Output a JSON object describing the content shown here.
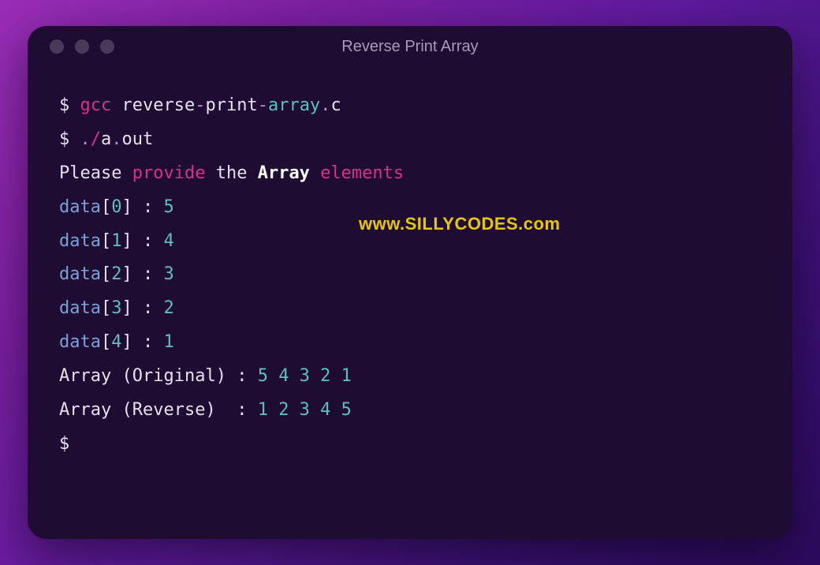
{
  "window": {
    "title": "Reverse Print Array"
  },
  "terminal": {
    "line1": {
      "prompt": "$ ",
      "gcc": "gcc",
      "sp1": " ",
      "reverse": "reverse",
      "dash1": "-",
      "print": "print",
      "dash2": "-",
      "array": "array",
      "dot": ".",
      "c": "c"
    },
    "line2": {
      "prompt": "$ ",
      "dot1": ".",
      "slash": "/",
      "a": "a",
      "dot2": ".",
      "out": "out"
    },
    "line3": {
      "please": "Please",
      "sp1": " ",
      "provide": "provide",
      "sp2": " ",
      "the": "the",
      "sp3": " ",
      "array": "Array",
      "sp4": " ",
      "elements": "elements"
    },
    "dataLines": [
      {
        "var": "data",
        "lb": "[",
        "idx": "0",
        "rb": "]",
        "sp": " ",
        "colon": ":",
        "sp2": " ",
        "val": "5"
      },
      {
        "var": "data",
        "lb": "[",
        "idx": "1",
        "rb": "]",
        "sp": " ",
        "colon": ":",
        "sp2": " ",
        "val": "4"
      },
      {
        "var": "data",
        "lb": "[",
        "idx": "2",
        "rb": "]",
        "sp": " ",
        "colon": ":",
        "sp2": " ",
        "val": "3"
      },
      {
        "var": "data",
        "lb": "[",
        "idx": "3",
        "rb": "]",
        "sp": " ",
        "colon": ":",
        "sp2": " ",
        "val": "2"
      },
      {
        "var": "data",
        "lb": "[",
        "idx": "4",
        "rb": "]",
        "sp": " ",
        "colon": ":",
        "sp2": " ",
        "val": "1"
      }
    ],
    "origLine": {
      "array": "Array",
      "sp1": " ",
      "lparen": "(",
      "original": "Original",
      "rparen": ")",
      "sp2": " ",
      "colon": ":",
      "sp3": " ",
      "values": "5 4 3 2 1"
    },
    "revLine": {
      "array": "Array",
      "sp1": " ",
      "lparen": "(",
      "reverse": "Reverse",
      "rparen": ")",
      "sp2": "  ",
      "colon": ":",
      "sp3": " ",
      "values": "1 2 3 4 5"
    },
    "lastPrompt": "$ "
  },
  "watermark": "www.SILLYCODES.com"
}
